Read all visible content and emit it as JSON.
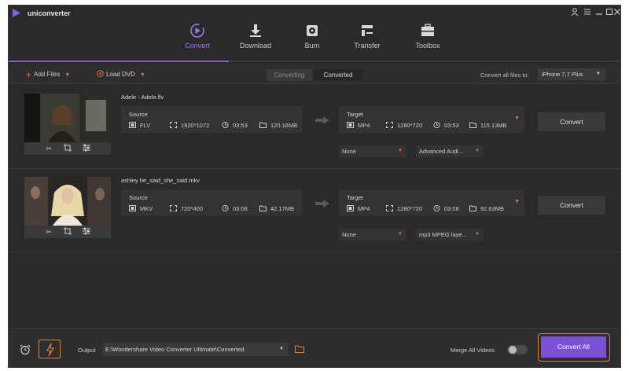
{
  "app": {
    "name": "uniconverter"
  },
  "nav": {
    "tabs": [
      {
        "label": "Convert",
        "icon": "convert-icon",
        "active": true
      },
      {
        "label": "Download",
        "icon": "download-icon",
        "active": false
      },
      {
        "label": "Burn",
        "icon": "burn-icon",
        "active": false
      },
      {
        "label": "Transfer",
        "icon": "transfer-icon",
        "active": false
      },
      {
        "label": "Toolbox",
        "icon": "toolbox-icon",
        "active": false
      }
    ]
  },
  "toolbar": {
    "add_files": "Add Files",
    "load_dvd": "Load DVD",
    "seg_converting": "Converting",
    "seg_converted": "Converted",
    "convert_all_to_label": "Convert all files to:",
    "convert_all_to_value": "iPhone 7,7 Plus"
  },
  "files": [
    {
      "name": "Adele - Adele.flv",
      "source": {
        "title": "Source",
        "format": "FLV",
        "resolution": "1920*1072",
        "duration": "03:53",
        "size": "120.16MB"
      },
      "target": {
        "title": "Target",
        "format": "MP4",
        "resolution": "1280*720",
        "duration": "03:53",
        "size": "115.13MB"
      },
      "subtitle": "None",
      "audio": "Advanced Audi...",
      "convert_label": "Convert"
    },
    {
      "name": "ashley he_said_she_said.mkv",
      "source": {
        "title": "Source",
        "format": "MKV",
        "resolution": "720*400",
        "duration": "03:08",
        "size": "42.17MB"
      },
      "target": {
        "title": "Target",
        "format": "MP4",
        "resolution": "1280*720",
        "duration": "03:08",
        "size": "92.63MB"
      },
      "subtitle": "None",
      "audio": "mp3 MPEG laye...",
      "convert_label": "Convert"
    }
  ],
  "bottom": {
    "output_label": "Output",
    "output_path": "E:\\Wondershare Video Converter Ultimate\\Converted",
    "merge_label": "Merge All Videos",
    "merge_on": false,
    "convert_all": "Convert All"
  },
  "colors": {
    "accent": "#7b4fd6",
    "highlight": "#e0803a",
    "background": "#2a2a2c"
  }
}
